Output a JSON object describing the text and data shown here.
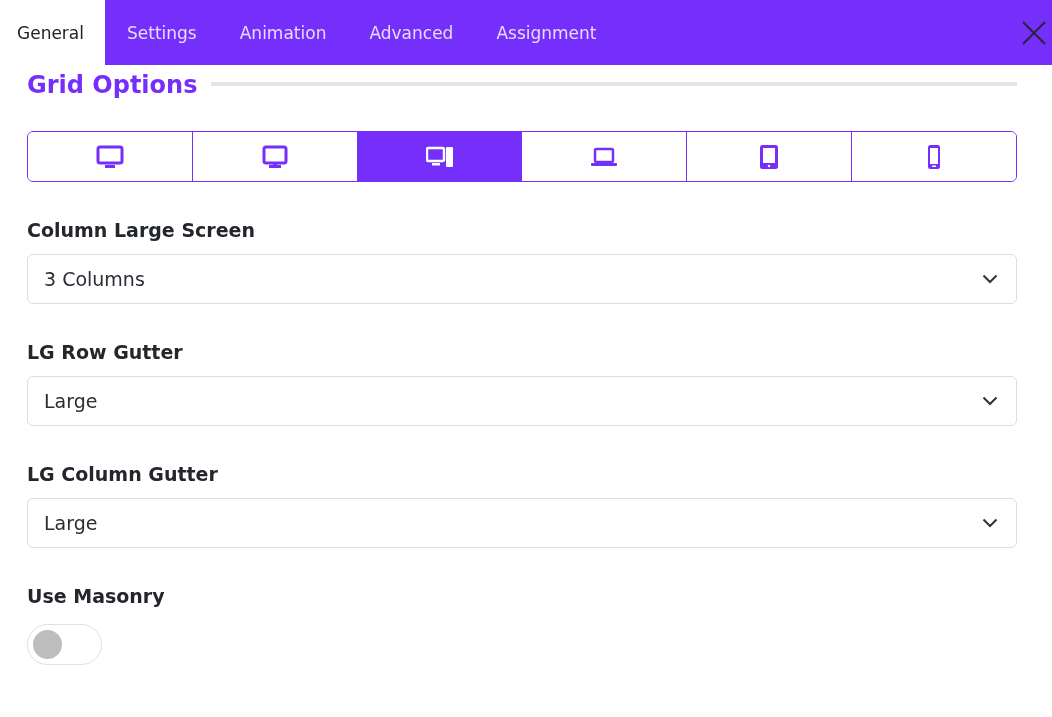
{
  "tabs": [
    {
      "label": "General",
      "selected": true
    },
    {
      "label": "Settings",
      "selected": false
    },
    {
      "label": "Animation",
      "selected": false
    },
    {
      "label": "Advanced",
      "selected": false
    },
    {
      "label": "Assignment",
      "selected": false
    }
  ],
  "section_title": "Grid Options",
  "devices": [
    {
      "kind": "desktop",
      "selected": false
    },
    {
      "kind": "monitor",
      "selected": false
    },
    {
      "kind": "tower",
      "selected": true
    },
    {
      "kind": "laptop",
      "selected": false
    },
    {
      "kind": "tablet",
      "selected": false
    },
    {
      "kind": "phone",
      "selected": false
    }
  ],
  "fields": [
    {
      "label": "Column Large Screen",
      "value": "3 Columns"
    },
    {
      "label": "LG Row Gutter",
      "value": "Large"
    },
    {
      "label": "LG Column Gutter",
      "value": "Large"
    }
  ],
  "masonry": {
    "label": "Use Masonry",
    "on": false
  }
}
